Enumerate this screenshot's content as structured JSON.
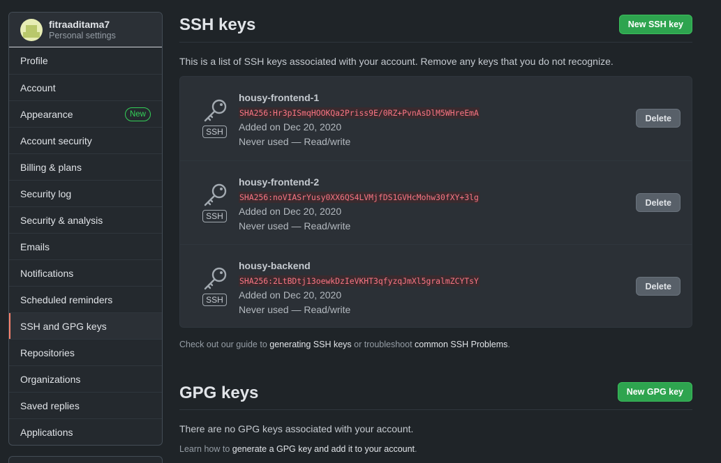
{
  "sidebar": {
    "username": "fitraaditama7",
    "subtitle": "Personal settings",
    "items": [
      {
        "label": "Profile"
      },
      {
        "label": "Account"
      },
      {
        "label": "Appearance",
        "badge": "New"
      },
      {
        "label": "Account security"
      },
      {
        "label": "Billing & plans"
      },
      {
        "label": "Security log"
      },
      {
        "label": "Security & analysis"
      },
      {
        "label": "Emails"
      },
      {
        "label": "Notifications"
      },
      {
        "label": "Scheduled reminders"
      },
      {
        "label": "SSH and GPG keys",
        "selected": true
      },
      {
        "label": "Repositories"
      },
      {
        "label": "Organizations"
      },
      {
        "label": "Saved replies"
      },
      {
        "label": "Applications"
      }
    ]
  },
  "ssh": {
    "title": "SSH keys",
    "new_button": "New SSH key",
    "intro": "This is a list of SSH keys associated with your account. Remove any keys that you do not recognize.",
    "badge": "SSH",
    "delete_label": "Delete",
    "keys": [
      {
        "name": "housy-frontend-1",
        "fingerprint": "SHA256:Hr3pISmqHOOKQa2Priss9E/0RZ+PvnAsDlM5WHreEmA",
        "added": "Added on Dec 20, 2020",
        "usage": "Never used — Read/write"
      },
      {
        "name": "housy-frontend-2",
        "fingerprint": "SHA256:noVIASrYusy0XX6QS4LVMjfDS1GVHcMohw30fXY+3lg",
        "added": "Added on Dec 20, 2020",
        "usage": "Never used — Read/write"
      },
      {
        "name": "housy-backend",
        "fingerprint": "SHA256:2LtBDtj13oewkDzIeVKHT3qfyzqJmXl5gralmZCYTsY",
        "added": "Added on Dec 20, 2020",
        "usage": "Never used — Read/write"
      }
    ],
    "help_prefix": "Check out our guide to ",
    "help_link1": "generating SSH keys",
    "help_middle": " or troubleshoot ",
    "help_link2": "common SSH Problems",
    "help_suffix": "."
  },
  "gpg": {
    "title": "GPG keys",
    "new_button": "New GPG key",
    "empty": "There are no GPG keys associated with your account.",
    "help_prefix": "Learn how to ",
    "help_link": "generate a GPG key and add it to your account",
    "help_suffix": "."
  },
  "colors": {
    "background": "#1f2428",
    "accent_green": "#2ea44f",
    "selected_indicator": "#f9826c",
    "fingerprint_red": "#f97583"
  },
  "icons": {
    "key": "key-icon"
  }
}
